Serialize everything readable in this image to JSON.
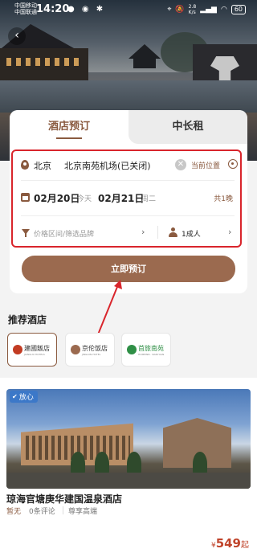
{
  "status": {
    "carrier1": "中国移动",
    "carrier2": "中国联通",
    "time": "14:20",
    "network_speed": "2.8",
    "network_unit": "K/s",
    "battery": "60"
  },
  "tabs": {
    "active": "酒店预订",
    "inactive": "中长租"
  },
  "search": {
    "city": "北京",
    "place": "北京南苑机场(已关闭)",
    "current_location": "当前位置",
    "checkin_date": "02月20日",
    "checkin_day": "今天",
    "checkout_date": "02月21日",
    "checkout_day": "周二",
    "nights": "共1晚",
    "filter_placeholder": "价格区间/筛选品牌",
    "guests": "1成人"
  },
  "book_button": "立即预订",
  "recommend": {
    "title": "推荐酒店",
    "brands": [
      {
        "name": "建國飯店",
        "sub": "JIANGUO HOTELS",
        "color": "#c23b22"
      },
      {
        "name": "京伦饭店",
        "sub": "JINGLUN HOTEL",
        "color": "#9b6a4f"
      },
      {
        "name": "首旅南苑",
        "sub": "HOMEINN · NANYUAN",
        "color": "#2f8f46"
      }
    ]
  },
  "hotel": {
    "badge": "放心",
    "name": "琼海官塘庚华建国温泉酒店",
    "score": "暂无",
    "reviews": "0条评论",
    "tag": "尊享高端",
    "price_currency": "¥",
    "price": "549",
    "price_suffix": "起"
  },
  "colors": {
    "accent": "#8a5a3f",
    "button": "#9b6a4f",
    "highlight": "#d9252c",
    "price": "#c0442b"
  }
}
